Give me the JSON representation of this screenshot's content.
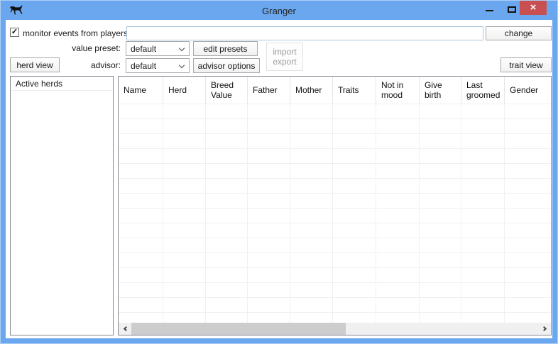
{
  "window": {
    "title": "Granger"
  },
  "titlebar": {
    "icon": "horse-icon",
    "close_glyph": "×"
  },
  "toolbar": {
    "monitor_label": "monitor events from players:",
    "monitor_checked": true,
    "check_glyph": "✓",
    "player_filter_value": "",
    "change_label": "change",
    "value_preset_label": "value preset:",
    "value_preset_selected": "default",
    "edit_presets_label": "edit presets",
    "advisor_label": "advisor:",
    "advisor_selected": "default",
    "advisor_options_label": "advisor options",
    "import_label": "import",
    "export_label": "export",
    "herd_view_label": "herd view",
    "trait_view_label": "trait view"
  },
  "sidebar": {
    "header": "Active herds",
    "items": []
  },
  "table": {
    "columns": [
      "Name",
      "Herd",
      "Breed Value",
      "Father",
      "Mother",
      "Traits",
      "Not in mood",
      "Give birth",
      "Last groomed",
      "Gender"
    ],
    "rows": []
  },
  "colors": {
    "titlebar_blue": "#6ba7ee",
    "close_red": "#c85050",
    "panel_border": "#828790",
    "grid_line": "#f0f0f0",
    "grid_line_vertical": "#edf1f7",
    "scrollbar_track": "#f0f0f0",
    "scrollbar_thumb": "#cdcdcd",
    "input_border": "#a9c5e2",
    "button_border": "#a8a8a8",
    "disabled_text": "#9e9e9e"
  }
}
